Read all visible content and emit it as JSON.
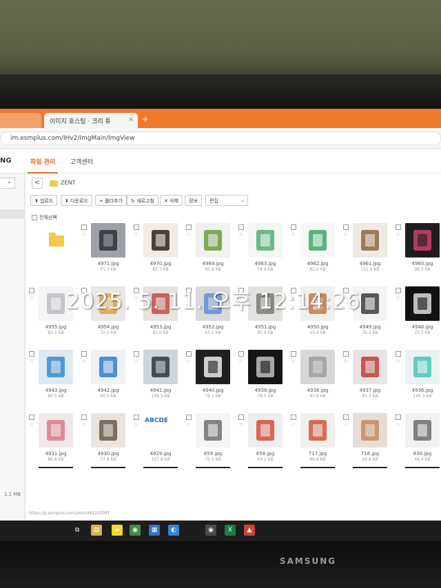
{
  "photo": {
    "timestamp": "2025. 5. 11. 오후 12:14:26",
    "monitor_brand": "SAMSUNG"
  },
  "browser": {
    "tabs": [
      {
        "label": "",
        "active": false
      },
      {
        "label": "이미지 호스팅 · 크리 튜",
        "active": true,
        "close": "×"
      }
    ],
    "new_tab": "+",
    "address": "im.esmplus.com/IHv2/ImgMain/ImgView"
  },
  "app": {
    "brand": "NG",
    "nav": [
      {
        "label": "파일 관리",
        "active": true
      },
      {
        "label": "고객센터",
        "active": false
      }
    ]
  },
  "sidebar": {
    "select_chevron": "⌄",
    "storage_size": "1.1 MB"
  },
  "path": {
    "back": "<",
    "folder": "ZENT"
  },
  "toolbar": {
    "buttons": [
      "⬆ 업로드",
      "⬇ 다운로드",
      "+ 폴더추가",
      "↻ 새로고침",
      "✕ 삭제",
      "정보"
    ],
    "select_value": "편집",
    "select_chevron": "⌄"
  },
  "select_all_label": "전체선택",
  "status_url": "https://g.esmplus.com/zent/4912/ZENT",
  "colors": {
    "accent": "#ee7a2c",
    "active_nav": "#e8672b"
  },
  "files": [
    {
      "name": "",
      "size": "",
      "icon": "folder-up-icon",
      "bg": "#ffffff",
      "fg": "#f3c94a"
    },
    {
      "name": "4971.jpg",
      "size": "71.3 KB",
      "bg": "#9ea1a8",
      "fg": "#2e3038"
    },
    {
      "name": "4970.jpg",
      "size": "83.3 KB",
      "bg": "#f1ece6",
      "fg": "#2a2320"
    },
    {
      "name": "4969.jpg",
      "size": "85.8 KB",
      "bg": "#eef1ec",
      "fg": "#6b9c3a"
    },
    {
      "name": "4963.jpg",
      "size": "74.9 KB",
      "bg": "#f4f6f4",
      "fg": "#4fae78"
    },
    {
      "name": "4962.jpg",
      "size": "82.0 KB",
      "bg": "#f6f7f6",
      "fg": "#38a86a"
    },
    {
      "name": "4961.jpg",
      "size": "111.9 KB",
      "bg": "#efeae2",
      "fg": "#8b6a3f"
    },
    {
      "name": "4960.jpg",
      "size": "98.5 KB",
      "bg": "#1e1e22",
      "fg": "#d13f6a"
    },
    {
      "name": "4955.jpg",
      "size": "83.5 KB",
      "bg": "#f4f4f4",
      "fg": "#b9bcc2"
    },
    {
      "name": "4954.jpg",
      "size": "72.0 KB",
      "bg": "#e9e7e3",
      "fg": "#d9a24a"
    },
    {
      "name": "4953.jpg",
      "size": "81.0 KB",
      "bg": "#e6e2dc",
      "fg": "#c44a4a"
    },
    {
      "name": "4952.jpg",
      "size": "53.1 KB",
      "bg": "#d8dadd",
      "fg": "#5b8fd6"
    },
    {
      "name": "4951.jpg",
      "size": "85.9 KB",
      "bg": "#e3e1de",
      "fg": "#7a7a7a"
    },
    {
      "name": "4950.jpg",
      "size": "53.4 KB",
      "bg": "#f1efec",
      "fg": "#c07a4a"
    },
    {
      "name": "4949.jpg",
      "size": "35.2 KB",
      "bg": "#f4f4f4",
      "fg": "#3b3b3b"
    },
    {
      "name": "4948.jpg",
      "size": "23.5 KB",
      "bg": "#111111",
      "fg": "#dcdcdc"
    },
    {
      "name": "4943.jpg",
      "size": "80.5 KB",
      "bg": "#dfe9f2",
      "fg": "#3a8ad0"
    },
    {
      "name": "4942.jpg",
      "size": "80.5 KB",
      "bg": "#eef2f6",
      "fg": "#2f7fd0"
    },
    {
      "name": "4941.jpg",
      "size": "139.3 KB",
      "bg": "#cfd3da",
      "fg": "#2e3440"
    },
    {
      "name": "4940.jpg",
      "size": "78.1 KB",
      "bg": "#202020",
      "fg": "#ececec"
    },
    {
      "name": "4939.jpg",
      "size": "78.5 KB",
      "bg": "#151515",
      "fg": "#bfbfbf"
    },
    {
      "name": "4938.jpg",
      "size": "97.9 KB",
      "bg": "#d7d7d7",
      "fg": "#9aa0a6"
    },
    {
      "name": "4937.jpg",
      "size": "81.3 KB",
      "bg": "#e7e4e1",
      "fg": "#c23b3b"
    },
    {
      "name": "4936.jpg",
      "size": "145.3 KB",
      "bg": "#e9f3f2",
      "fg": "#4cc6b8"
    },
    {
      "name": "4931.jpg",
      "size": "86.8 KB",
      "bg": "#f2e8ea",
      "fg": "#d77a8b"
    },
    {
      "name": "4930.jpg",
      "size": "77.8 KB",
      "bg": "#e9e4df",
      "fg": "#6a5a4a"
    },
    {
      "name": "4929.jpg",
      "size": "107.8 KB",
      "bg": "#ffffff",
      "fg": "#2f6bd0",
      "label": "ABCDE"
    },
    {
      "name": "859.jpg",
      "size": "75.5 KB",
      "bg": "#f4f4f4",
      "fg": "#6e6e6e"
    },
    {
      "name": "858.jpg",
      "size": "63.2 KB",
      "bg": "#eeeeee",
      "fg": "#d94a3a"
    },
    {
      "name": "717.jpg",
      "size": "80.8 KB",
      "bg": "#f1efec",
      "fg": "#d4553a"
    },
    {
      "name": "716.jpg",
      "size": "69.8 KB",
      "bg": "#e6ded6",
      "fg": "#c98a5a"
    },
    {
      "name": "830.jpg",
      "size": "48.4 KB",
      "bg": "#f1f1f1",
      "fg": "#6b6b6b"
    }
  ],
  "taskbar": [
    {
      "icon": "task-view-icon",
      "glyph": "⧉",
      "bg": "#1d1d1d"
    },
    {
      "icon": "file-explorer-icon",
      "glyph": "▤",
      "bg": "#d6b24a"
    },
    {
      "icon": "kakaotalk-icon",
      "glyph": "▰",
      "bg": "#f7d52a"
    },
    {
      "icon": "chrome-icon",
      "glyph": "◉",
      "bg": "#3d8d4a"
    },
    {
      "icon": "app-icon",
      "glyph": "▦",
      "bg": "#3a6fc4"
    },
    {
      "icon": "edge-icon",
      "glyph": "◐",
      "bg": "#2f86d6"
    },
    {
      "icon": "chrome-active-icon",
      "glyph": "◉",
      "bg": "#4a4a4a"
    },
    {
      "icon": "excel-icon",
      "glyph": "X",
      "bg": "#1f7a45"
    },
    {
      "icon": "app-red-icon",
      "glyph": "▲",
      "bg": "#c8453a"
    }
  ]
}
